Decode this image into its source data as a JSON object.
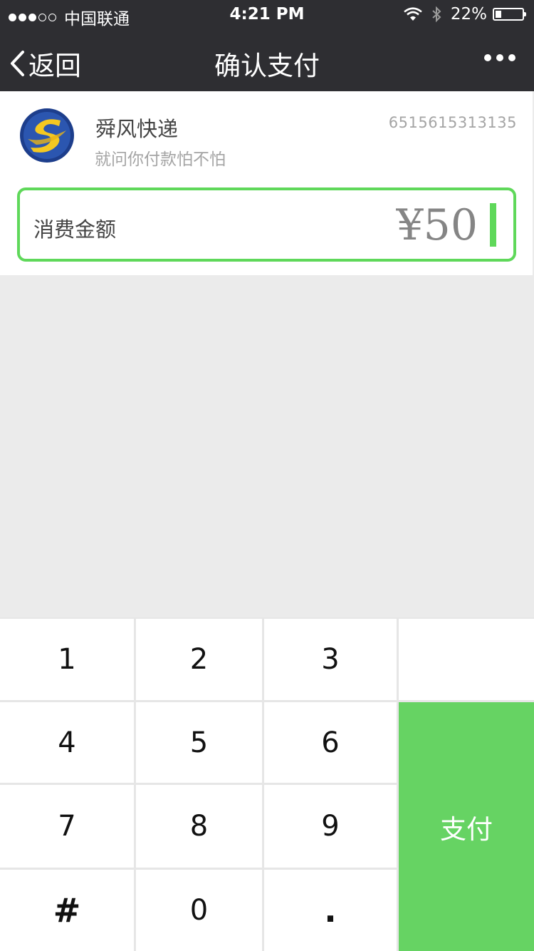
{
  "status_bar": {
    "carrier": "中国联通",
    "time": "4:21 PM",
    "battery": "22%",
    "battery_level": 0.22
  },
  "nav": {
    "back_label": "返回",
    "title": "确认支付"
  },
  "merchant": {
    "name": "舜风快递",
    "subtitle": "就问你付款怕不怕",
    "id": "6515615313135"
  },
  "amount": {
    "label": "消费金额",
    "value": "¥50"
  },
  "keypad": {
    "k1": "1",
    "k2": "2",
    "k3": "3",
    "k4": "4",
    "k5": "5",
    "k6": "6",
    "k7": "7",
    "k8": "8",
    "k9": "9",
    "hash": "#",
    "k0": "0",
    "dot": ".",
    "pay_label": "支付"
  },
  "colors": {
    "nav_bg": "#2e2e32",
    "accent_green": "#66d363",
    "background": "#ebebeb"
  }
}
